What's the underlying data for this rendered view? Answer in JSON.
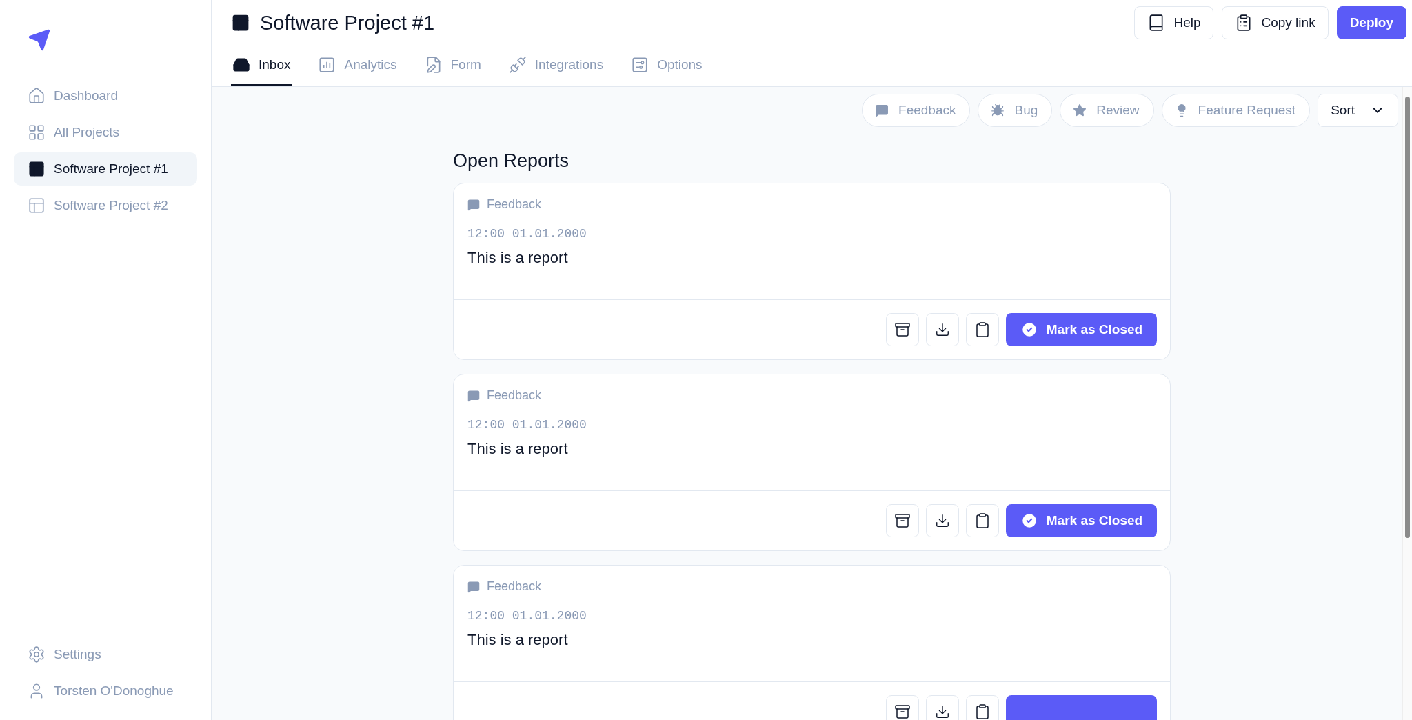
{
  "sidebar": {
    "items": [
      {
        "label": "Dashboard",
        "selected": false
      },
      {
        "label": "All Projects",
        "selected": false
      },
      {
        "label": "Software Project #1",
        "selected": true
      },
      {
        "label": "Software Project #2",
        "selected": false
      }
    ],
    "footer": [
      {
        "label": "Settings"
      },
      {
        "label": "Torsten O'Donoghue"
      }
    ]
  },
  "header": {
    "title": "Software Project #1",
    "buttons": [
      {
        "label": "Help",
        "kind": "outline"
      },
      {
        "label": "Copy link",
        "kind": "outline"
      },
      {
        "label": "Deploy",
        "kind": "primary"
      }
    ]
  },
  "tabs": [
    {
      "label": "Inbox",
      "selected": true
    },
    {
      "label": "Analytics",
      "selected": false
    },
    {
      "label": "Form",
      "selected": false
    },
    {
      "label": "Integrations",
      "selected": false
    },
    {
      "label": "Options",
      "selected": false
    }
  ],
  "filters": [
    {
      "label": "Feedback"
    },
    {
      "label": "Bug"
    },
    {
      "label": "Review"
    },
    {
      "label": "Feature Request"
    }
  ],
  "sort": {
    "label": "Sort"
  },
  "section_title": "Open Reports",
  "reports": [
    {
      "tag": "Feedback",
      "time": "12:00 01.01.2000",
      "text": "This is a report",
      "action": "Mark as Closed"
    },
    {
      "tag": "Feedback",
      "time": "12:00 01.01.2000",
      "text": "This is a report",
      "action": "Mark as Closed"
    },
    {
      "tag": "Feedback",
      "time": "12:00 01.01.2000",
      "text": "This is a report"
    }
  ]
}
